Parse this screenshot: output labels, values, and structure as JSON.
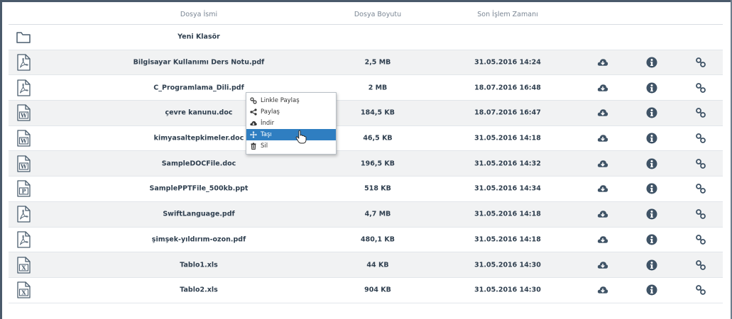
{
  "header": {
    "name_label": "Dosya İsmi",
    "size_label": "Dosya Boyutu",
    "date_label": "Son İşlem Zamanı"
  },
  "colors": {
    "icon_gray": "#4a5d6e",
    "row_alt": "#f1f2f3",
    "menu_active": "#2f7ec1"
  },
  "folder": {
    "name": "Yeni Klasör",
    "icon": "folder-icon"
  },
  "files": [
    {
      "name": "Bilgisayar Kullanımı Ders Notu.pdf",
      "size": "2,5 MB",
      "date": "31.05.2016 14:24",
      "type": "pdf"
    },
    {
      "name": "C_Programlama_Dili.pdf",
      "size": "2 MB",
      "date": "18.07.2016 16:48",
      "type": "pdf"
    },
    {
      "name": "çevre kanunu.doc",
      "size": "184,5 KB",
      "date": "18.07.2016 16:47",
      "type": "doc"
    },
    {
      "name": "kimyasaltepkimeler.doc",
      "size": "46,5 KB",
      "date": "31.05.2016 14:18",
      "type": "doc"
    },
    {
      "name": "SampleDOCFile.doc",
      "size": "196,5 KB",
      "date": "31.05.2016 14:32",
      "type": "doc"
    },
    {
      "name": "SamplePPTFile_500kb.ppt",
      "size": "518 KB",
      "date": "31.05.2016 14:34",
      "type": "ppt"
    },
    {
      "name": "SwiftLanguage.pdf",
      "size": "4,7 MB",
      "date": "31.05.2016 14:18",
      "type": "pdf"
    },
    {
      "name": "şimşek-yıldırım-ozon.pdf",
      "size": "480,1 KB",
      "date": "31.05.2016 14:18",
      "type": "pdf"
    },
    {
      "name": "Tablo1.xls",
      "size": "44 KB",
      "date": "31.05.2016 14:30",
      "type": "xls"
    },
    {
      "name": "Tablo2.xls",
      "size": "904 KB",
      "date": "31.05.2016 14:30",
      "type": "xls"
    }
  ],
  "context_menu": {
    "items": [
      {
        "label": "Linkle Paylaş",
        "icon": "link-icon"
      },
      {
        "label": "Paylaş",
        "icon": "share-icon"
      },
      {
        "label": "İndir",
        "icon": "cloud-download-icon"
      },
      {
        "label": "Taşı",
        "icon": "move-icon",
        "active": true
      },
      {
        "label": "Sil",
        "icon": "trash-icon"
      }
    ]
  }
}
